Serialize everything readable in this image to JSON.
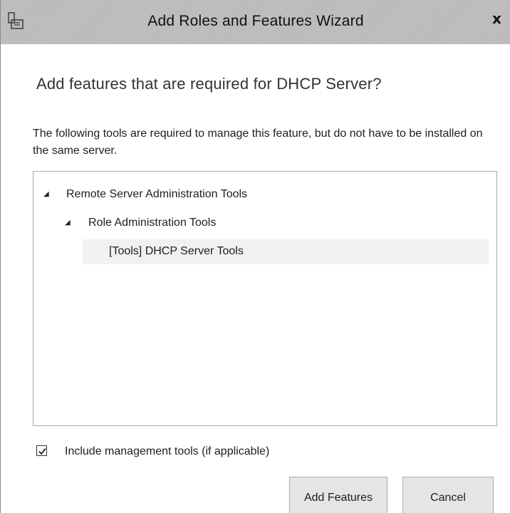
{
  "window": {
    "title": "Add Roles and Features Wizard",
    "close_glyph": "x",
    "icon": "wizard-app-icon"
  },
  "dialog": {
    "heading": "Add features that are required for DHCP Server?",
    "description": "The following tools are required to manage this feature, but do not have to be installed on the same server."
  },
  "tree": {
    "expander_glyph": "◢",
    "items": [
      {
        "label": "Remote Server Administration Tools",
        "level": 0,
        "expanded": true
      },
      {
        "label": "Role Administration Tools",
        "level": 1,
        "expanded": true
      },
      {
        "label": "[Tools] DHCP Server Tools",
        "level": 2,
        "selected": true
      }
    ]
  },
  "options": {
    "include_tools_label": "Include management tools (if applicable)",
    "include_tools_checked": true
  },
  "buttons": {
    "add_features": "Add Features",
    "cancel": "Cancel"
  },
  "colors": {
    "titlebar": "#bdbdbd",
    "button_face": "#e5e5e5",
    "selection_row": "#f1f1f1"
  }
}
